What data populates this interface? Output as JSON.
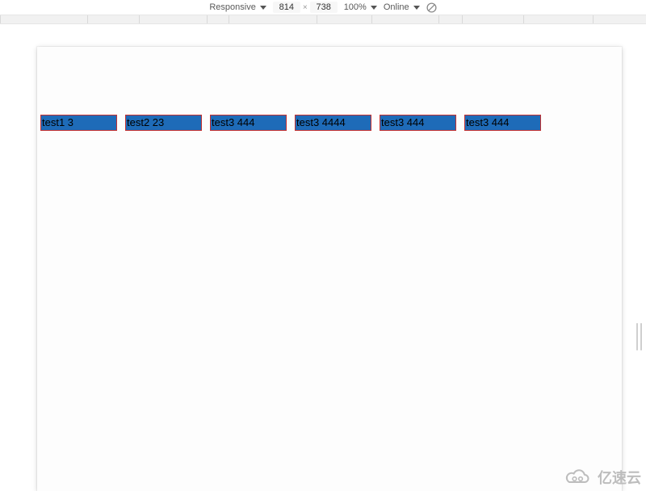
{
  "toolbar": {
    "device_label": "Responsive",
    "width": "814",
    "height": "738",
    "zoom": "100%",
    "network": "Online"
  },
  "ruler": {
    "segments": [
      0,
      108,
      172,
      256,
      283,
      392,
      460,
      543,
      572,
      648,
      734
    ]
  },
  "boxes": [
    "test1 3",
    "test2 23",
    "test3 444",
    "test3 4444",
    "test3 444",
    "test3 444"
  ],
  "watermark": {
    "text": "亿速云"
  }
}
